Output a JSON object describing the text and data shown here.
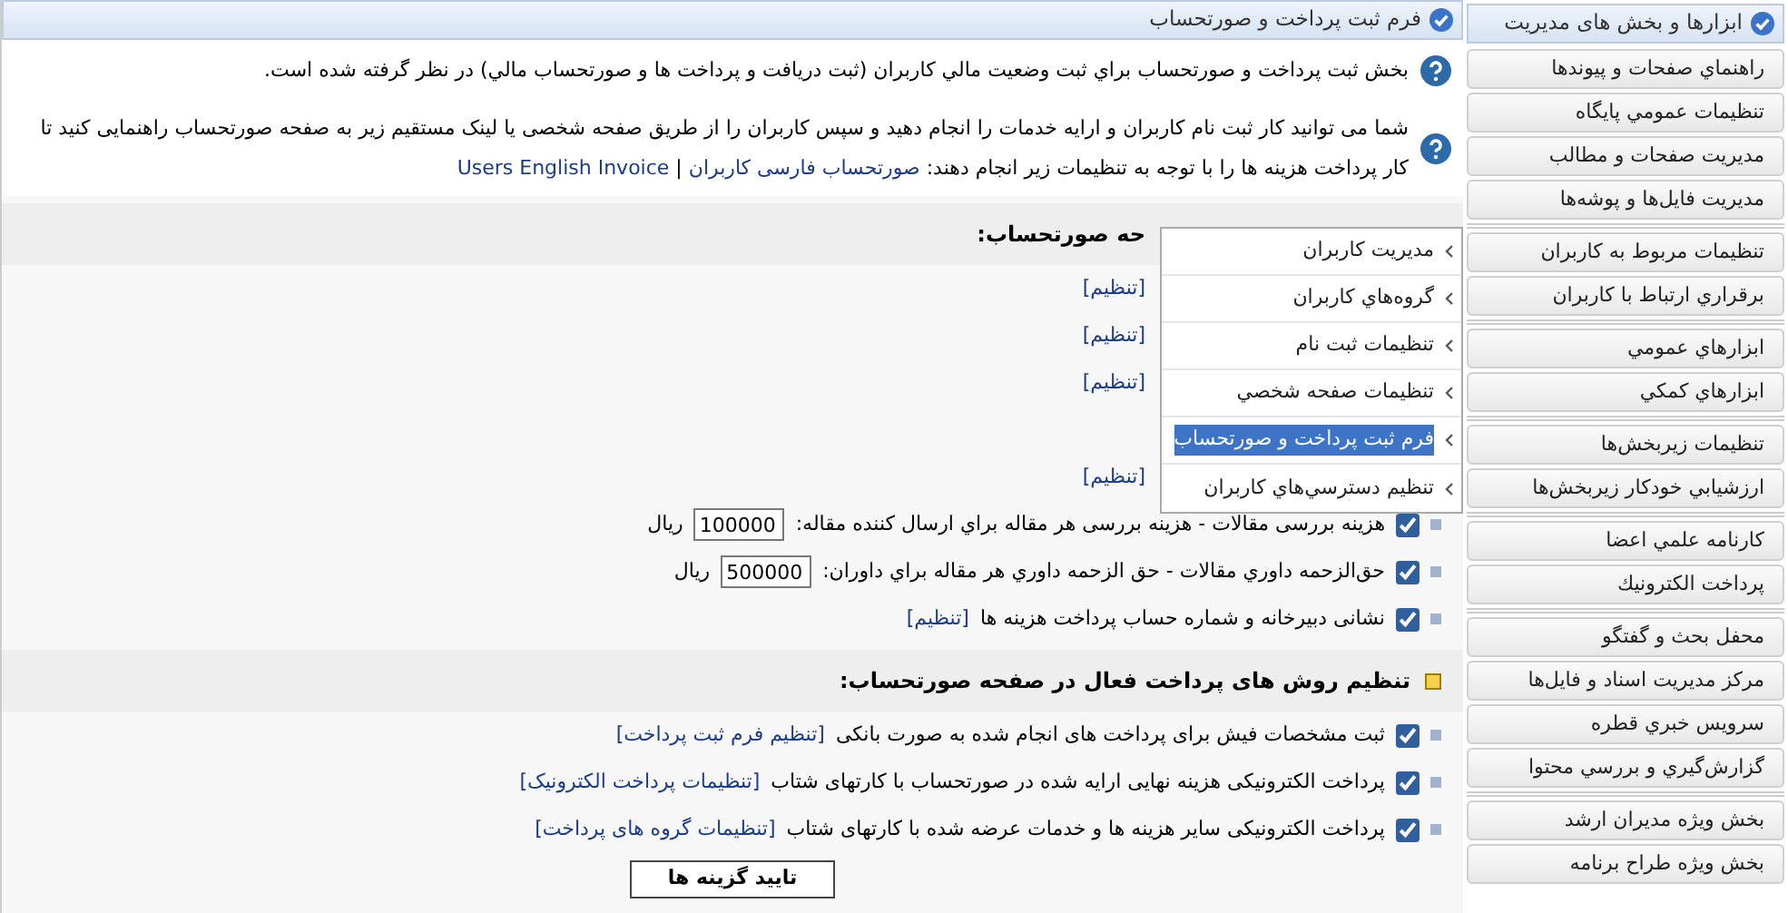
{
  "main": {
    "title": "فرم ثبت پرداخت و صورتحساب",
    "intro": [
      {
        "text": "بخش ثبت پرداخت و صورتحساب براي ثبت وضعيت مالي كاربران (ثبت دريافت و پرداخت ها و صورتحساب مالي) در نظر گرفته شده است."
      },
      {
        "text": "شما می توانید کار ثبت نام کاربران و ارایه خدمات را انجام دهید و سپس کاربران را از طریق صفحه شخصی یا لینک مستقیم زیر به صفحه صورتحساب راهنمایی کنید تا کار پرداخت هزینه ها را با توجه به تنظیمات زیر انجام دهند:",
        "links": [
          "صورتحساب فارسی کاربران",
          "Users English Invoice"
        ],
        "separator": "|"
      }
    ],
    "sections": [
      {
        "heading": "حه صورتحساب:",
        "covered": true,
        "rows": [
          {
            "kind": "covered",
            "link": "[تنظیم]"
          },
          {
            "kind": "covered",
            "link": "[تنظیم]"
          },
          {
            "kind": "covered",
            "link": "[تنظیم]"
          },
          {
            "kind": "blank"
          },
          {
            "kind": "covered",
            "link": "[تنظیم]"
          },
          {
            "kind": "fee",
            "checked": true,
            "label": "هزینه بررسی مقالات - هزینه بررسی هر مقاله براي ارسال كننده مقاله:",
            "value": "100000",
            "unit": "ريال"
          },
          {
            "kind": "fee",
            "checked": true,
            "label": "حق‌الزحمه داوري مقالات - حق الزحمه داوري هر مقاله براي داوران:",
            "value": "500000",
            "unit": "ريال"
          },
          {
            "kind": "link",
            "checked": true,
            "label": "نشانی دبیرخانه و شماره حساب پرداخت هزینه ها",
            "link": "[تنظیم]"
          }
        ]
      },
      {
        "heading": "تنظیم روش های پرداخت فعال در صفحه صورتحساب:",
        "covered": false,
        "rows": [
          {
            "kind": "link",
            "checked": true,
            "label": "ثبت مشخصات فیش برای پرداخت های انجام شده به صورت بانکی",
            "link": "[تنظیم فرم ثبت پرداخت]"
          },
          {
            "kind": "link",
            "checked": true,
            "label": "پرداخت الکترونیکی هزینه نهایی ارایه شده در صورتحساب با کارتهای شتاب",
            "link": "[تنظیمات پرداخت الکترونیک]"
          },
          {
            "kind": "link",
            "checked": true,
            "label": "پرداخت الکترونیکی سایر هزینه ها و خدمات عرضه شده با کارتهای شتاب",
            "link": "[تنظیمات گروه های پرداخت]"
          }
        ]
      }
    ],
    "submit": "تایید گزینه ها"
  },
  "sidebar": {
    "title": "ابزارها و بخش های مدیریت",
    "groups": [
      {
        "items": [
          {
            "label": "راهنماي صفحات و پيوندها"
          },
          {
            "label": "تنظيمات عمومي پايگاه"
          },
          {
            "label": "مديريت صفحات و مطالب"
          },
          {
            "label": "مديريت فايل‌ها و پوشه‌ها"
          }
        ]
      },
      {
        "items": [
          {
            "label": "تنظيمات مربوط به كاربران",
            "submenu": [
              {
                "label": "مدیریت کاربران",
                "selected": false
              },
              {
                "label": "گروه‌هاي كاربران",
                "selected": false
              },
              {
                "label": "تنظيمات ثبت نام",
                "selected": false
              },
              {
                "label": "تنظيمات صفحه شخصي",
                "selected": false
              },
              {
                "label": "فرم ثبت پرداخت و صورتحساب",
                "selected": true
              },
              {
                "label": "تنظيم دسترسي‌هاي كاربران",
                "selected": false
              }
            ]
          },
          {
            "label": "برقراري ارتباط با كاربران"
          }
        ]
      },
      {
        "items": [
          {
            "label": "ابزارهاي عمومي"
          },
          {
            "label": "ابزارهاي كمكي"
          }
        ]
      },
      {
        "items": [
          {
            "label": "تنظيمات زيربخش‌ها"
          },
          {
            "label": "ارزشيابي خودكار زيربخش‌ها"
          }
        ]
      },
      {
        "items": [
          {
            "label": "كارنامه علمي اعضا"
          },
          {
            "label": "پرداخت الكترونيك"
          }
        ]
      },
      {
        "items": [
          {
            "label": "محفل بحث و گفتگو"
          },
          {
            "label": "مركز مديريت اسناد و فايل‌ها"
          },
          {
            "label": "سرويس خبري قطره"
          },
          {
            "label": "گزارش‌گيري و بررسي محتوا"
          }
        ]
      },
      {
        "items": [
          {
            "label": "بخش ويژه مديران ارشد"
          },
          {
            "label": "بخش ويژه طراح برنامه"
          }
        ]
      }
    ]
  }
}
